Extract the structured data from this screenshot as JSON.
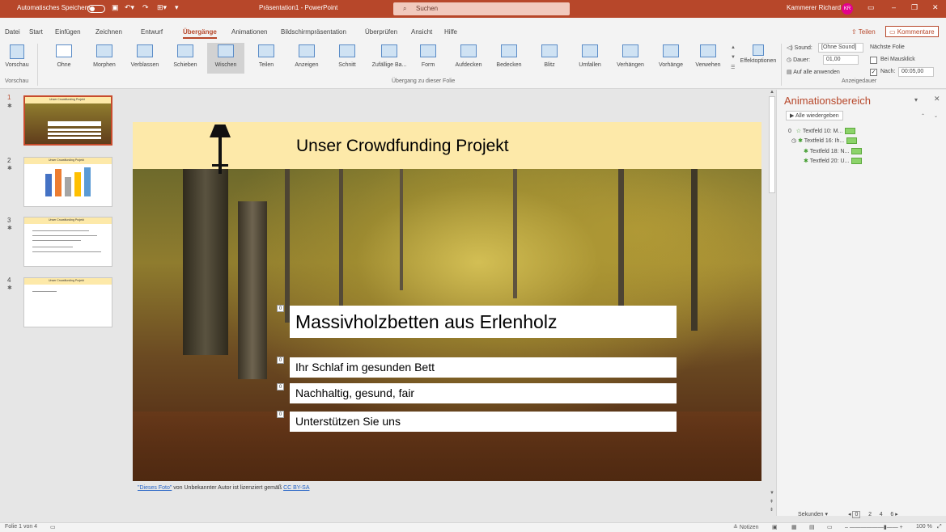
{
  "titlebar": {
    "autosave": "Automatisches Speichern",
    "doc_title": "Präsentation1 - PowerPoint",
    "search_placeholder": "Suchen",
    "user": "Kammerer Richard",
    "avatar_initials": "KR"
  },
  "menu": {
    "tabs": [
      "Datei",
      "Start",
      "Einfügen",
      "Zeichnen",
      "Entwurf",
      "Übergänge",
      "Animationen",
      "Bildschirmpräsentation",
      "Überprüfen",
      "Ansicht",
      "Hilfe"
    ],
    "active_tab": "Übergänge",
    "share": "Teilen",
    "comments": "Kommentare"
  },
  "ribbon": {
    "preview": "Vorschau",
    "preview_group": "Vorschau",
    "transitions": [
      "Ohne",
      "Morphen",
      "Verblassen",
      "Schieben",
      "Wischen",
      "Teilen",
      "Anzeigen",
      "Schnitt",
      "Zufällige Ba...",
      "Form",
      "Aufdecken",
      "Bedecken",
      "Blitz",
      "Umfallen",
      "Verhängen",
      "Vorhänge",
      "Verwehen"
    ],
    "selected_transition": "Wischen",
    "effect_options": "Effektoptionen",
    "transition_group": "Übergang zu dieser Folie",
    "timing": {
      "sound_label": "Sound:",
      "sound_value": "[Ohne Sound]",
      "duration_label": "Dauer:",
      "duration_value": "01,00",
      "apply_all": "Auf alle anwenden",
      "next_slide": "Nächste Folie",
      "on_click": "Bei Mausklick",
      "after_label": "Nach:",
      "after_value": "00:05,00",
      "group": "Anzeigedauer"
    }
  },
  "thumbnails": [
    {
      "num": "1",
      "title": "Unser Crowdfunding Projekt"
    },
    {
      "num": "2",
      "title": "Unser Crowdfunding Projekt"
    },
    {
      "num": "3",
      "title": "Unser Crowdfunding Projekt"
    },
    {
      "num": "4",
      "title": "Unser Crowdfunding Projekt"
    }
  ],
  "slide": {
    "title": "Unser Crowdfunding Projekt",
    "headline": "Massivholzbetten aus Erlenholz",
    "bullets": [
      "Ihr Schlaf im gesunden Bett",
      "Nachhaltig, gesund, fair",
      "Unterstützen Sie uns"
    ],
    "anim_numbers": [
      "0",
      "0",
      "0",
      "0"
    ],
    "caption_link": "\"Dieses Foto\"",
    "caption_text": " von Unbekannter Autor ist lizenziert gemäß ",
    "caption_license": "CC BY-SA"
  },
  "animpane": {
    "title": "Animationsbereich",
    "play_all": "Alle wiedergeben",
    "items": [
      {
        "num": "0",
        "label": "Textfeld 10: M..."
      },
      {
        "num": "",
        "label": "Textfeld 16: Ih..."
      },
      {
        "num": "",
        "label": "Textfeld 18: N..."
      },
      {
        "num": "",
        "label": "Textfeld 20: U..."
      }
    ],
    "seconds": "Sekunden",
    "scale": [
      "0",
      "2",
      "4",
      "6"
    ]
  },
  "status": {
    "slide_count": "Folie 1 von 4",
    "notes": "Notizen",
    "zoom": "100 %"
  }
}
